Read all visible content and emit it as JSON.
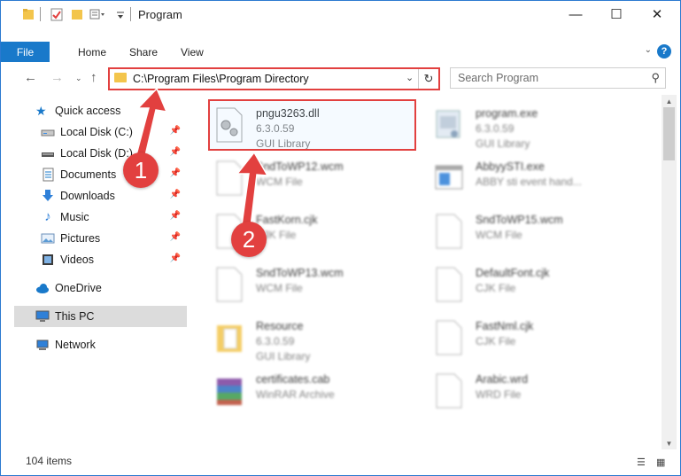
{
  "window": {
    "title": "Program",
    "controls": {
      "minimize": "—",
      "maximize": "☐",
      "close": "✕"
    }
  },
  "ribbon": {
    "tabs": [
      "File",
      "Home",
      "Share",
      "View"
    ],
    "help": "?"
  },
  "navbar": {
    "address": "C:\\Program Files\\Program Directory",
    "search_placeholder": "Search Program"
  },
  "sidebar": {
    "items": [
      {
        "label": "Quick access",
        "icon": "star-icon",
        "pinned": false
      },
      {
        "label": "Local Disk (C:)",
        "icon": "drive-icon",
        "pinned": true
      },
      {
        "label": "Local Disk (D:)",
        "icon": "drive-icon",
        "pinned": true
      },
      {
        "label": "Documents",
        "icon": "documents-icon",
        "pinned": true
      },
      {
        "label": "Downloads",
        "icon": "download-icon",
        "pinned": true
      },
      {
        "label": "Music",
        "icon": "music-icon",
        "pinned": true
      },
      {
        "label": "Pictures",
        "icon": "pictures-icon",
        "pinned": true
      },
      {
        "label": "Videos",
        "icon": "videos-icon",
        "pinned": true
      },
      {
        "label": "OneDrive",
        "icon": "cloud-icon",
        "pinned": false
      },
      {
        "label": "This PC",
        "icon": "computer-icon",
        "pinned": false
      },
      {
        "label": "Network",
        "icon": "network-icon",
        "pinned": false
      }
    ]
  },
  "files": {
    "left": [
      {
        "name": "pngu3263.dll",
        "line2": "6.3.0.59",
        "line3": "GUI Library",
        "icon": "dll-gear-icon"
      },
      {
        "name": "SndToWP12.wcm",
        "line2": "WCM File",
        "line3": "",
        "icon": "blank-file-icon"
      },
      {
        "name": "FastKorn.cjk",
        "line2": "CJK File",
        "line3": "",
        "icon": "blank-file-icon"
      },
      {
        "name": "SndToWP13.wcm",
        "line2": "WCM File",
        "line3": "",
        "icon": "blank-file-icon"
      },
      {
        "name": "Resource",
        "line2": "6.3.0.59",
        "line3": "GUI Library",
        "icon": "folder-file-icon"
      },
      {
        "name": "certificates.cab",
        "line2": "WinRAR Archive",
        "line3": "",
        "icon": "winrar-icon"
      }
    ],
    "right": [
      {
        "name": "program.exe",
        "line2": "6.3.0.59",
        "line3": "GUI Library",
        "icon": "exe-icon"
      },
      {
        "name": "AbbyySTI.exe",
        "line2": "ABBY sti event hand...",
        "line3": "",
        "icon": "window-app-icon"
      },
      {
        "name": "SndToWP15.wcm",
        "line2": "WCM File",
        "line3": "",
        "icon": "blank-file-icon"
      },
      {
        "name": "DefaultFont.cjk",
        "line2": "CJK File",
        "line3": "",
        "icon": "blank-file-icon"
      },
      {
        "name": "FastNml.cjk",
        "line2": "CJK File",
        "line3": "",
        "icon": "blank-file-icon"
      },
      {
        "name": "Arabic.wrd",
        "line2": "WRD File",
        "line3": "",
        "icon": "blank-file-icon"
      }
    ]
  },
  "status": {
    "count": "104 items"
  },
  "annotations": {
    "step1": "1",
    "step2": "2",
    "color": "#e2403f"
  },
  "colors": {
    "accent": "#1979ca",
    "highlight": "#e2403f",
    "folder": "#f3c54c"
  }
}
